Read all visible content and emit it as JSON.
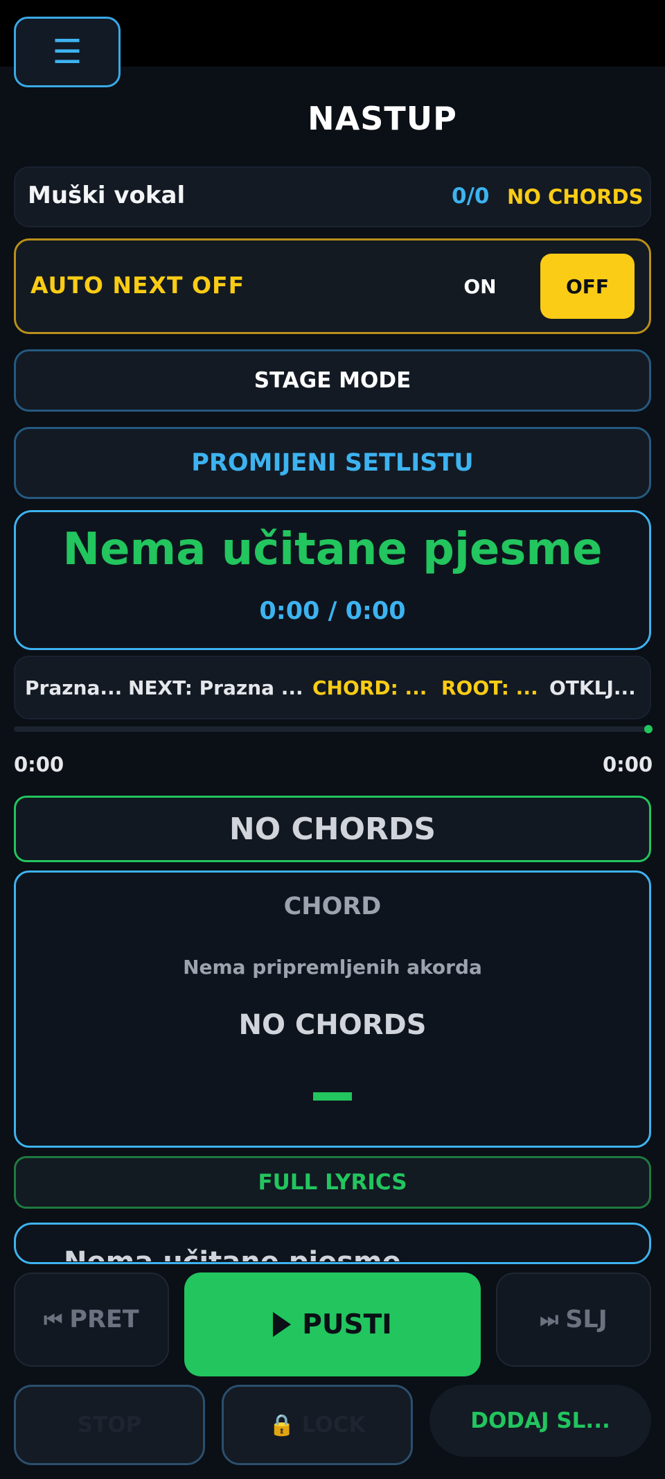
{
  "header": {
    "title": "NASTUP",
    "menu_icon": "hamburger-menu-icon",
    "menu_glyph": "☰"
  },
  "song_row": {
    "name": "Muški vokal",
    "count": "0/0",
    "chords_status": "NO CHORDS"
  },
  "auto_next": {
    "label": "AUTO NEXT OFF",
    "on_label": "ON",
    "off_label": "OFF"
  },
  "buttons": {
    "stage_mode": "STAGE MODE",
    "change_setlist": "PROMIJENI SETLISTU",
    "full_lyrics": "FULL LYRICS",
    "prev": "PRET",
    "play": "PUSTI",
    "next": "SLJ",
    "stop": "STOP",
    "lock": "LOCK",
    "add": "DODAJ SL..."
  },
  "now_playing": {
    "title": "Nema učitane pjesme",
    "time": "0:00 / 0:00"
  },
  "info_row": {
    "current": "Prazna...",
    "next": "NEXT: Prazna ...",
    "chord": "CHORD: ...",
    "root": "ROOT: ...",
    "lock_state": "OTKLJ..."
  },
  "progress": {
    "elapsed": "0:00",
    "total": "0:00",
    "fraction": 0
  },
  "chords": {
    "status_bar": "NO CHORDS",
    "card_heading": "CHORD",
    "card_sub": "Nema pripremljenih akorda",
    "card_main": "NO CHORDS"
  },
  "lyrics_preview": "Nema učitane pjesme",
  "icons": {
    "prev": "⏮",
    "next": "⏭",
    "lock": "🔒"
  },
  "colors": {
    "accent_green": "#22c55e",
    "accent_blue": "#3db3f0",
    "accent_yellow": "#facc15",
    "background": "#0b0f16"
  }
}
